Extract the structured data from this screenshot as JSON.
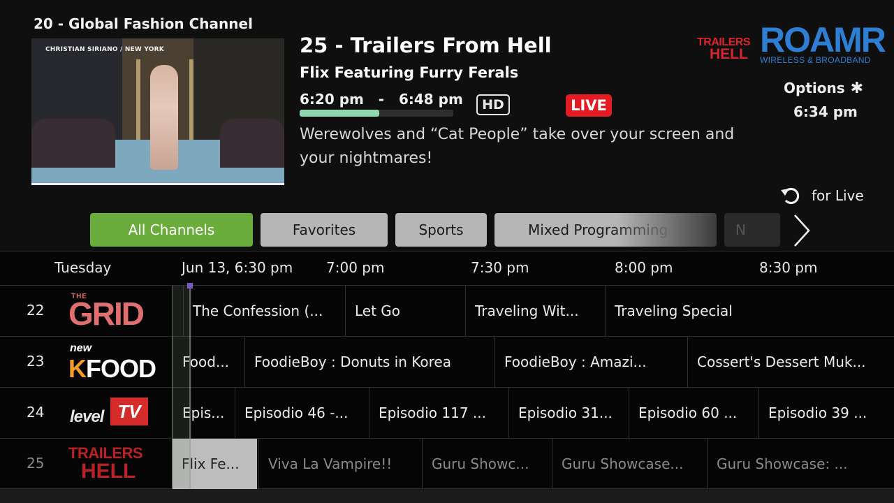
{
  "preview": {
    "channel": "20 - Global Fashion Channel",
    "caption": "CHRISTIAN SIRIANO / NEW YORK"
  },
  "program": {
    "channel": "25 - Trailers From Hell",
    "title": "Flix Featuring Furry Ferals",
    "start": "6:20 pm",
    "separator": "-",
    "end": "6:48 pm",
    "progress_fraction": 0.52,
    "hd_label": "HD",
    "live_label": "LIVE",
    "description": "Werewolves and “Cat People” take over your screen and your nightmares!"
  },
  "logos": {
    "tfh_line1": "TRAILERS",
    "tfh_line2": "HELL",
    "roamr_name": "ROAMR",
    "roamr_tagline": "WIRELESS & BROADBAND"
  },
  "options": {
    "label": "Options",
    "star": "✱",
    "clock": "6:34 pm"
  },
  "live_hint": {
    "icon": "replay-icon",
    "text": "for  Live"
  },
  "filters": {
    "items": [
      {
        "label": "All Channels",
        "active": true
      },
      {
        "label": "Favorites",
        "active": false
      },
      {
        "label": "Sports",
        "active": false
      },
      {
        "label": "Mixed Programming",
        "active": false
      },
      {
        "label": "N",
        "active": false
      }
    ],
    "next_icon": "chevron-right-icon"
  },
  "timeline": {
    "day": "Tuesday",
    "slots": [
      "Jun 13, 6:30 pm",
      "7:00 pm",
      "7:30 pm",
      "8:00 pm",
      "8:30 pm"
    ]
  },
  "channels": [
    {
      "number": "22",
      "logo_text_top": "THE",
      "logo_text": "GRID",
      "programs": [
        "The Confession (...",
        "Let Go",
        "Traveling Wit...",
        "Traveling Special"
      ]
    },
    {
      "number": "23",
      "logo_text_top": "new",
      "logo_text_k": "K",
      "logo_text": "FOOD",
      "programs": [
        "Food...",
        "FoodieBoy : Donuts in Korea",
        "FoodieBoy : Amazi...",
        "Cossert's Dessert Muk..."
      ]
    },
    {
      "number": "24",
      "logo_text": "level",
      "logo_text_tv": "TV",
      "programs": [
        "Epis...",
        "Episodio 46 -...",
        "Episodio 117 ...",
        "Episodio 31...",
        "Episodio 60 ...",
        "Episodio 39 ..."
      ]
    },
    {
      "number": "25",
      "logo_text_top": "TRAILERS",
      "logo_text": "HELL",
      "programs": [
        "Flix Fe...",
        "Viva La Vampire!!",
        "Guru Showc...",
        "Guru Showcase...",
        "Guru Showcase: ..."
      ]
    }
  ]
}
